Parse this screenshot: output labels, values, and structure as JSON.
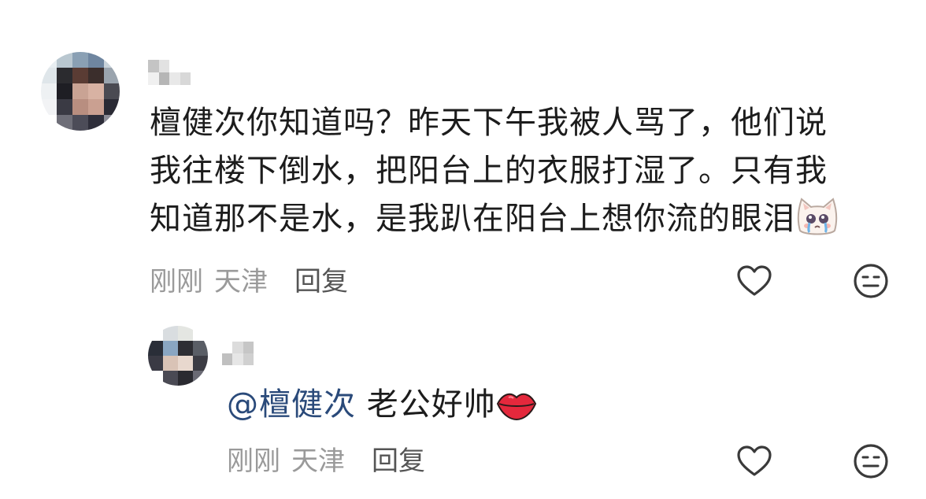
{
  "comments": [
    {
      "author_name": "",
      "text_lines": [
        "檀健次你知道吗？昨天下午我被人骂了，他们说",
        "我往楼下倒水，把阳台上的衣服打湿了。只有我",
        "知道那不是水，是我趴在阳台上想你流的眼泪"
      ],
      "trailing_emoji": "crying-cat-emoji",
      "time": "刚刚",
      "location": "天津",
      "reply_label": "回复",
      "like_icon": "heart-icon",
      "dislike_icon": "meh-face-icon"
    },
    {
      "author_name": "",
      "mention": "@檀健次",
      "text": " 老公好帅",
      "trailing_emoji": "lips-emoji",
      "time": "刚刚",
      "location": "天津",
      "reply_label": "回复",
      "like_icon": "heart-icon",
      "dislike_icon": "meh-face-icon"
    }
  ],
  "colors": {
    "text": "#1c1c1c",
    "meta": "#9a9a9a",
    "reply": "#555555",
    "mention": "#2a4a7a",
    "icon": "#3a3a3a"
  }
}
